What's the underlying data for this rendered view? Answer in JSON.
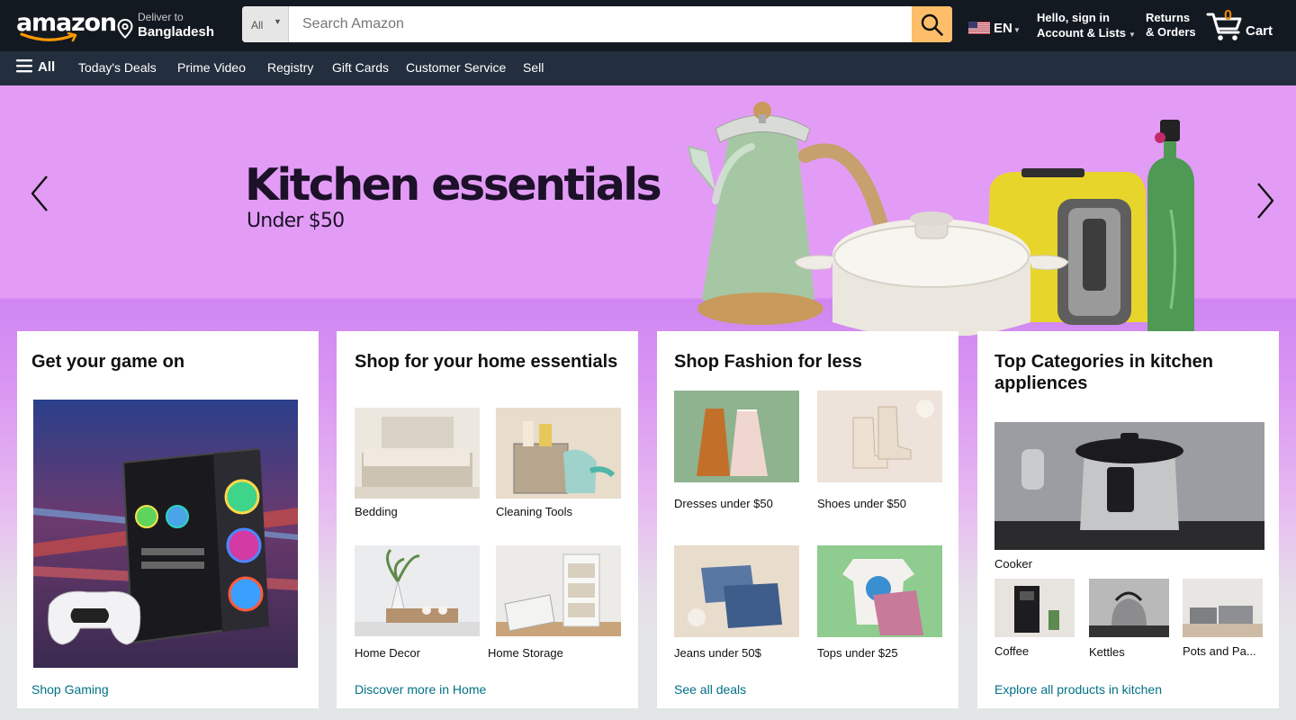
{
  "header": {
    "logo_text": "amazon",
    "deliver_to_label": "Deliver to",
    "deliver_to_location": "Bangladesh",
    "search": {
      "category": "All",
      "placeholder": "Search Amazon"
    },
    "language": "EN",
    "account_greeting": "Hello, sign in",
    "account_menu": "Account & Lists",
    "returns_line1": "Returns",
    "returns_line2": "& Orders",
    "cart_count": "0",
    "cart_label": "Cart"
  },
  "subnav": {
    "all": "All",
    "items": [
      "Today's Deals",
      "Prime Video",
      "Registry",
      "Gift Cards",
      "Customer Service",
      "Sell"
    ]
  },
  "hero": {
    "title": "Kitchen essentials",
    "subtitle": "Under $50"
  },
  "cards": [
    {
      "title": "Get your game on",
      "link": "Shop Gaming"
    },
    {
      "title": "Shop for your home essentials",
      "tiles": [
        "Bedding",
        "Cleaning Tools",
        "Home Decor",
        "Home Storage"
      ],
      "link": "Discover more in Home"
    },
    {
      "title": "Shop Fashion for less",
      "tiles": [
        "Dresses under $50",
        "Shoes under $50",
        "Jeans under 50$",
        "Tops under $25"
      ],
      "link": "See all deals"
    },
    {
      "title": "Top Categories in kitchen appliences",
      "main_tile": "Cooker",
      "tiles": [
        "Coffee",
        "Kettles",
        "Pots and Pa..."
      ],
      "link": "Explore all products in kitchen"
    }
  ],
  "colors": {
    "nav_dark": "#131921",
    "nav_sub": "#232f3e",
    "search_button": "#febd69",
    "cart_count": "#f08804",
    "link": "#007185",
    "hero_bg": "#e39cf6"
  }
}
